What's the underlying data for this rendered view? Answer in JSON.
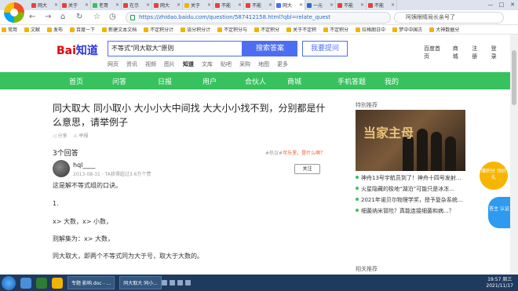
{
  "browser": {
    "tabs": [
      {
        "label": "网大",
        "color": "#e6413b"
      },
      {
        "label": "关于",
        "color": "#e6413b"
      },
      {
        "label": "老哥",
        "color": "#37c25d"
      },
      {
        "label": "在示",
        "color": "#e6413b"
      },
      {
        "label": "网大",
        "color": "#e6413b"
      },
      {
        "label": "关于",
        "color": "#f0b400"
      },
      {
        "label": "不能",
        "color": "#e6413b"
      },
      {
        "label": "不能",
        "color": "#e6413b"
      },
      {
        "label": "网大",
        "color": "#4e6ef2"
      },
      {
        "label": "一元",
        "color": "#2b6cc4"
      },
      {
        "label": "不能",
        "color": "#e6413b"
      },
      {
        "label": "不能",
        "color": "#e6413b"
      }
    ],
    "url_prefix": "https://",
    "url": "https://zhidao.baidu.com/question/587412158.html?qbl=relate_quest",
    "search_placeholder": "阿姨眼睛局长亲号了",
    "bookmarks": [
      "常用",
      "文献",
      "发布",
      "百度一下",
      "新建文本文档",
      "不定积分计",
      "谈分积分计",
      "不定积分与",
      "不定积分",
      "关于不定积",
      "不定积分",
      "拉格朗日中",
      "梦中中国古",
      "大神数据分"
    ]
  },
  "header": {
    "logo_red": "Bai",
    "logo_blue": "知道",
    "query": "不等式\"同大取大\"原则",
    "search_button": "搜索答案",
    "ask_button": "我要提问",
    "links": [
      "百度首页",
      "商城",
      "注册",
      "登录"
    ],
    "categories": [
      "网页",
      "资讯",
      "视频",
      "图片",
      "知道",
      "文库",
      "贴吧",
      "采购",
      "地图",
      "更多"
    ],
    "active_category": "知道"
  },
  "nav": {
    "items": [
      "首页",
      "问答",
      "日报",
      "用户",
      "合伙人",
      "商城",
      "手机答题",
      "我的"
    ]
  },
  "question": {
    "title": "同大取大 同小取小 大小小大中间找 大大小小找不到，分别都是什么意思，请举例子",
    "share": "分享",
    "report": "举报",
    "answer_count": "3个回答",
    "tip_prefix": "#热议#",
    "tip_link": "可乐里，是什么啊？"
  },
  "answer": {
    "user": "hql____",
    "date": "2013-08-31 · TA获得超过3.6万个赞",
    "follow": "关注",
    "lines": [
      "这是解不等式组的口诀。",
      "1.",
      "x> 大数，x> 小数，",
      "则解集为：x> 大数，",
      "同大取大，即两个不等式同为大于号，取大于大数的。"
    ]
  },
  "sidebar": {
    "header": "特别推荐",
    "poster_title": "当家主母",
    "items": [
      "神舟13号宇航员到了！神舟十四号发射...",
      "火星隐藏的极地“湖泊”可能只是冰冻...",
      "2021年诺贝尔物理学奖，授予复杂系统...",
      "细菌纳米冒险？真能连接细菌和病...？"
    ],
    "related_header": "相关推荐"
  },
  "float_badges": {
    "reward": "赚积分 领好礼",
    "certify": "答主 认证"
  },
  "taskbar": {
    "tasks": [
      "专题 影响.doc - ...",
      "同大取大 同小..."
    ],
    "time": "19:57 周三",
    "date": "2021/11/17"
  }
}
